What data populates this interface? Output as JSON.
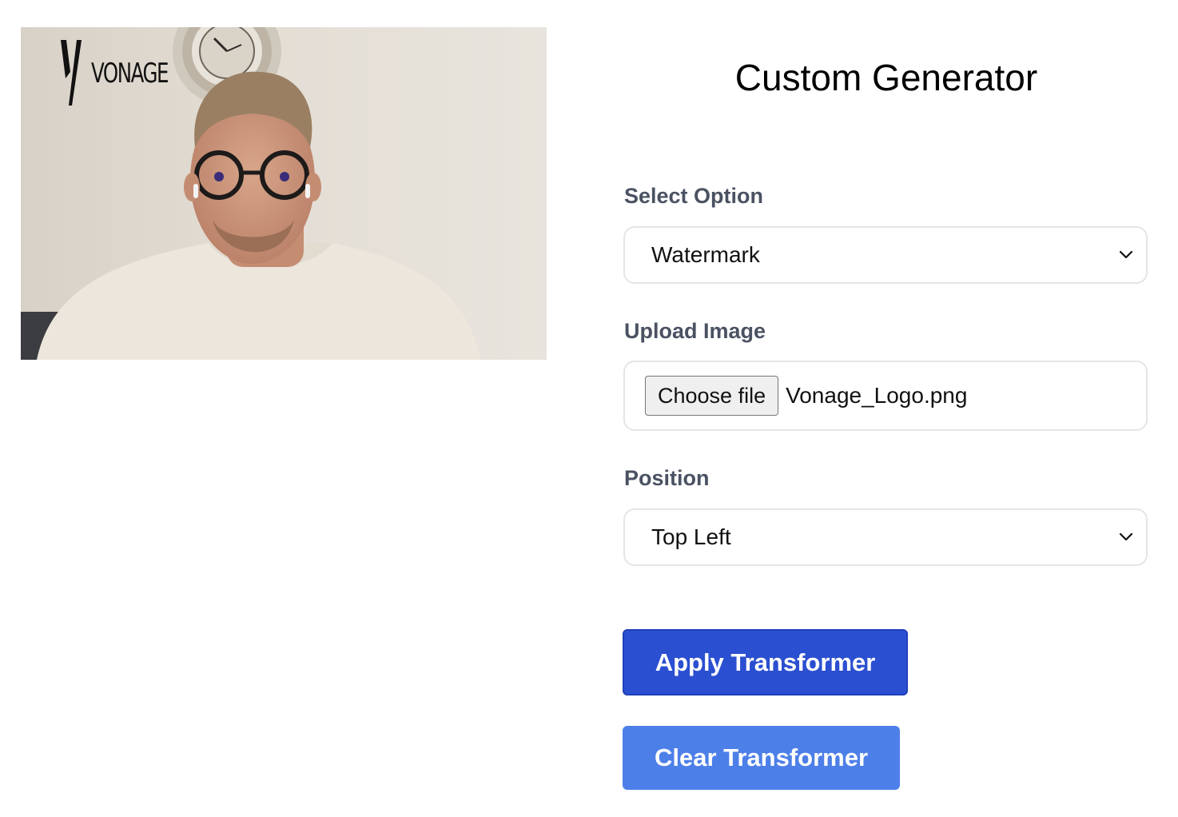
{
  "video": {
    "watermark_text": "VONAGE"
  },
  "panel": {
    "title": "Custom Generator",
    "select_option": {
      "label": "Select Option",
      "value": "Watermark"
    },
    "upload_image": {
      "label": "Upload Image",
      "button_label": "Choose file",
      "file_name": "Vonage_Logo.png"
    },
    "position": {
      "label": "Position",
      "value": "Top Left"
    },
    "apply_label": "Apply Transformer",
    "clear_label": "Clear Transformer"
  },
  "colors": {
    "apply_button": "#2b4fd1",
    "clear_button": "#4d7fe8",
    "label_text": "#4a5262"
  },
  "icons": {
    "select_chevron": "chevron-down-icon",
    "watermark_mark": "vonage-logo-icon"
  }
}
